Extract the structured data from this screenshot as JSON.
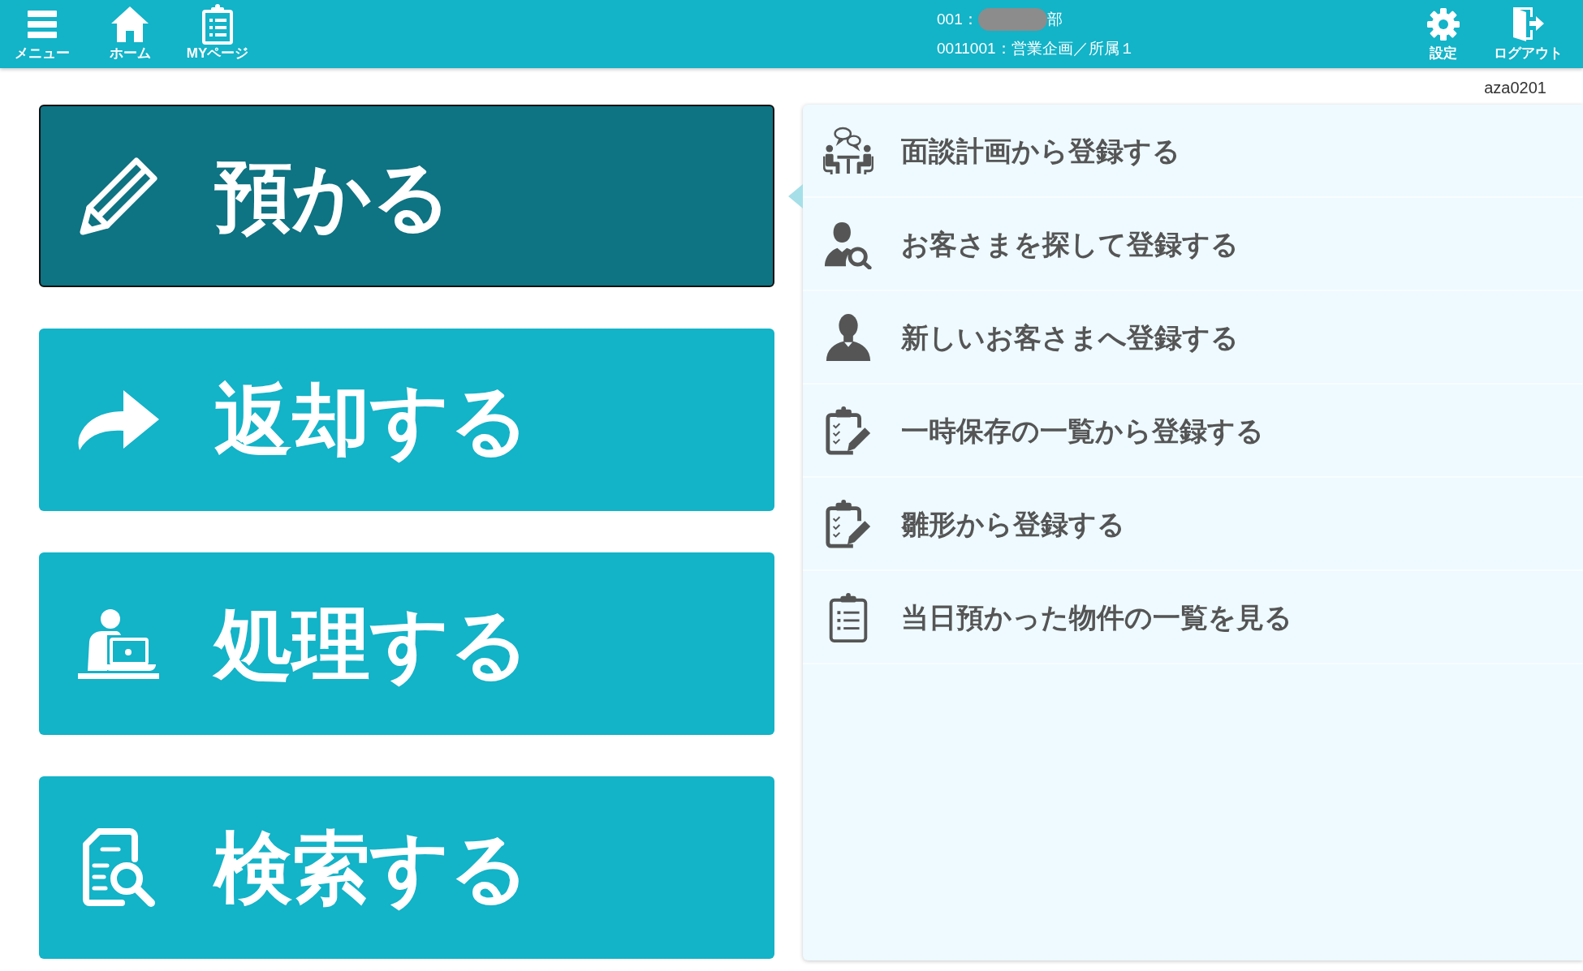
{
  "header": {
    "nav": [
      {
        "label": "メニュー"
      },
      {
        "label": "ホーム"
      },
      {
        "label": "MYページ"
      }
    ],
    "org": {
      "line_1": {
        "prefix": "001：",
        "redacted": true,
        "suffix": "部"
      },
      "line_2": "0011001：営業企画／所属１"
    },
    "actions": [
      {
        "label": "設定"
      },
      {
        "label": "ログアウト"
      }
    ]
  },
  "screen_id": "aza0201",
  "main_actions": [
    {
      "label": "預かる",
      "selected": true
    },
    {
      "label": "返却する",
      "selected": false
    },
    {
      "label": "処理する",
      "selected": false
    },
    {
      "label": "検索する",
      "selected": false
    }
  ],
  "sub_actions": [
    {
      "label": "面談計画から登録する"
    },
    {
      "label": "お客さまを探して登録する"
    },
    {
      "label": "新しいお客さまへ登録する"
    },
    {
      "label": "一時保存の一覧から登録する"
    },
    {
      "label": "雛形から登録する"
    },
    {
      "label": "当日預かった物件の一覧を見る"
    }
  ]
}
